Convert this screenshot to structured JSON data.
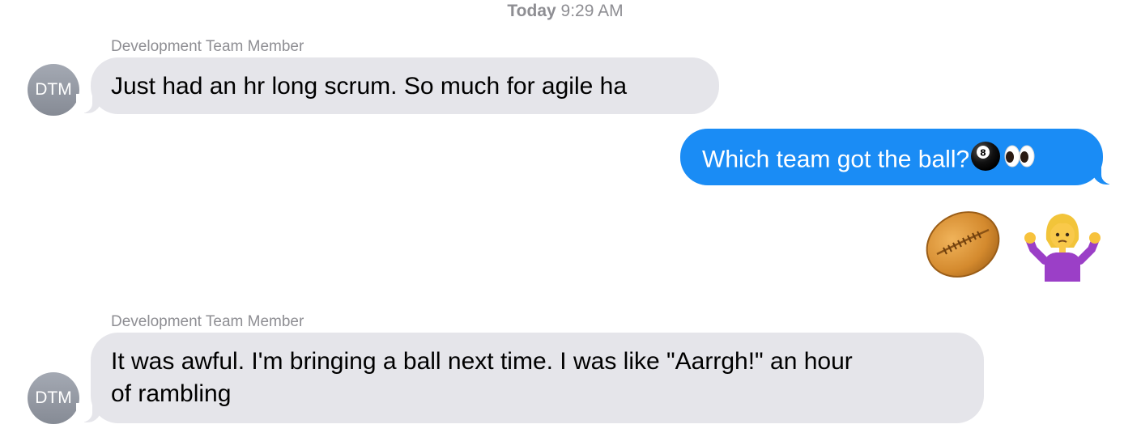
{
  "thread": {
    "timestamp_day": "Today",
    "timestamp_time": "9:29 AM",
    "messages": [
      {
        "direction": "incoming",
        "sender": "Development Team Member",
        "avatar_initials": "DTM",
        "text": "Just had an hr long scrum. So much for agile ha"
      },
      {
        "direction": "outgoing",
        "text": "Which team got the ball?",
        "emojis": [
          "8-ball-icon",
          "eyes-icon"
        ]
      },
      {
        "direction": "outgoing",
        "emojis": [
          "rugby-football-icon",
          "person-shrugging-icon"
        ]
      },
      {
        "direction": "incoming",
        "sender": "Development Team Member",
        "avatar_initials": "DTM",
        "text_line1": "It was awful. I'm bringing a ball next time. I was like \"Aarrgh!\" an hour",
        "text_line2": "of rambling"
      }
    ]
  },
  "colors": {
    "incoming_bubble": "#e5e5ea",
    "outgoing_bubble": "#1a8cf5",
    "meta_text": "#8e8e93"
  }
}
